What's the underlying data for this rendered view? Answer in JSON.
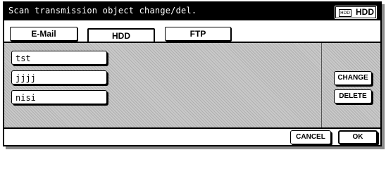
{
  "title": "Scan transmission object change/del.",
  "mode_indicator": {
    "icon": "hdd-icon",
    "icon_text": "HDD",
    "label": "HDD"
  },
  "tabs": [
    {
      "label": "E-Mail",
      "active": false
    },
    {
      "label": "HDD",
      "active": true
    },
    {
      "label": "FTP",
      "active": false
    }
  ],
  "destinations": [
    {
      "name": "tst"
    },
    {
      "name": "jjjj"
    },
    {
      "name": "nisi"
    }
  ],
  "actions": {
    "change_label": "CHANGE",
    "delete_label": "DELETE"
  },
  "footer": {
    "cancel_label": "CANCEL",
    "ok_label": "OK"
  },
  "colors": {
    "title_bar": "#000000",
    "panel_background": "#c9c9c9"
  }
}
